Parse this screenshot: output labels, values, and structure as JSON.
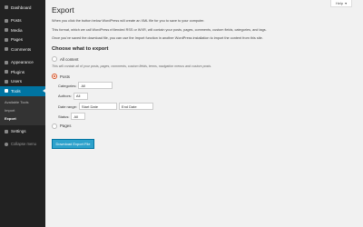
{
  "sidebar": {
    "items": [
      {
        "label": "Dashboard",
        "icon": "dashboard-icon"
      },
      {
        "label": "Posts",
        "icon": "pin-icon"
      },
      {
        "label": "Media",
        "icon": "media-icon"
      },
      {
        "label": "Pages",
        "icon": "page-icon"
      },
      {
        "label": "Comments",
        "icon": "comment-icon"
      },
      {
        "label": "Appearance",
        "icon": "brush-icon"
      },
      {
        "label": "Plugins",
        "icon": "plugin-icon"
      },
      {
        "label": "Users",
        "icon": "users-icon"
      },
      {
        "label": "Tools",
        "icon": "wrench-icon"
      }
    ],
    "submenu": [
      "Available Tools",
      "Import",
      "Export"
    ],
    "settings": {
      "label": "Settings",
      "icon": "settings-icon"
    },
    "collapse": "Collapse menu"
  },
  "help": {
    "label": "Help",
    "arrow": "▾"
  },
  "page": {
    "title": "Export",
    "intro1": "When you click the button below WordPress will create an XML file for you to save to your computer.",
    "intro2": "This format, which we call WordPress eXtended RSS or WXR, will contain your posts, pages, comments, custom fields, categories, and tags.",
    "intro3": "Once you've saved the download file, you can use the Import function in another WordPress installation to import the content from this site.",
    "choose": "Choose what to export",
    "all_content": "All content",
    "all_desc": "This will contain all of your posts, pages, comments, custom fields, terms, navigation menus and custom posts.",
    "posts": "Posts",
    "categories_label": "Categories:",
    "categories_value": "All",
    "authors_label": "Authors:",
    "authors_value": "All",
    "date_label": "Date range:",
    "start_date": "Start Date",
    "end_date": "End Date",
    "status_label": "Status:",
    "status_value": "All",
    "pages": "Pages",
    "button": "Download Export File"
  },
  "colors": {
    "accent": "#0074a2",
    "button": "#2ea2cc",
    "radio": "#d54e21"
  }
}
